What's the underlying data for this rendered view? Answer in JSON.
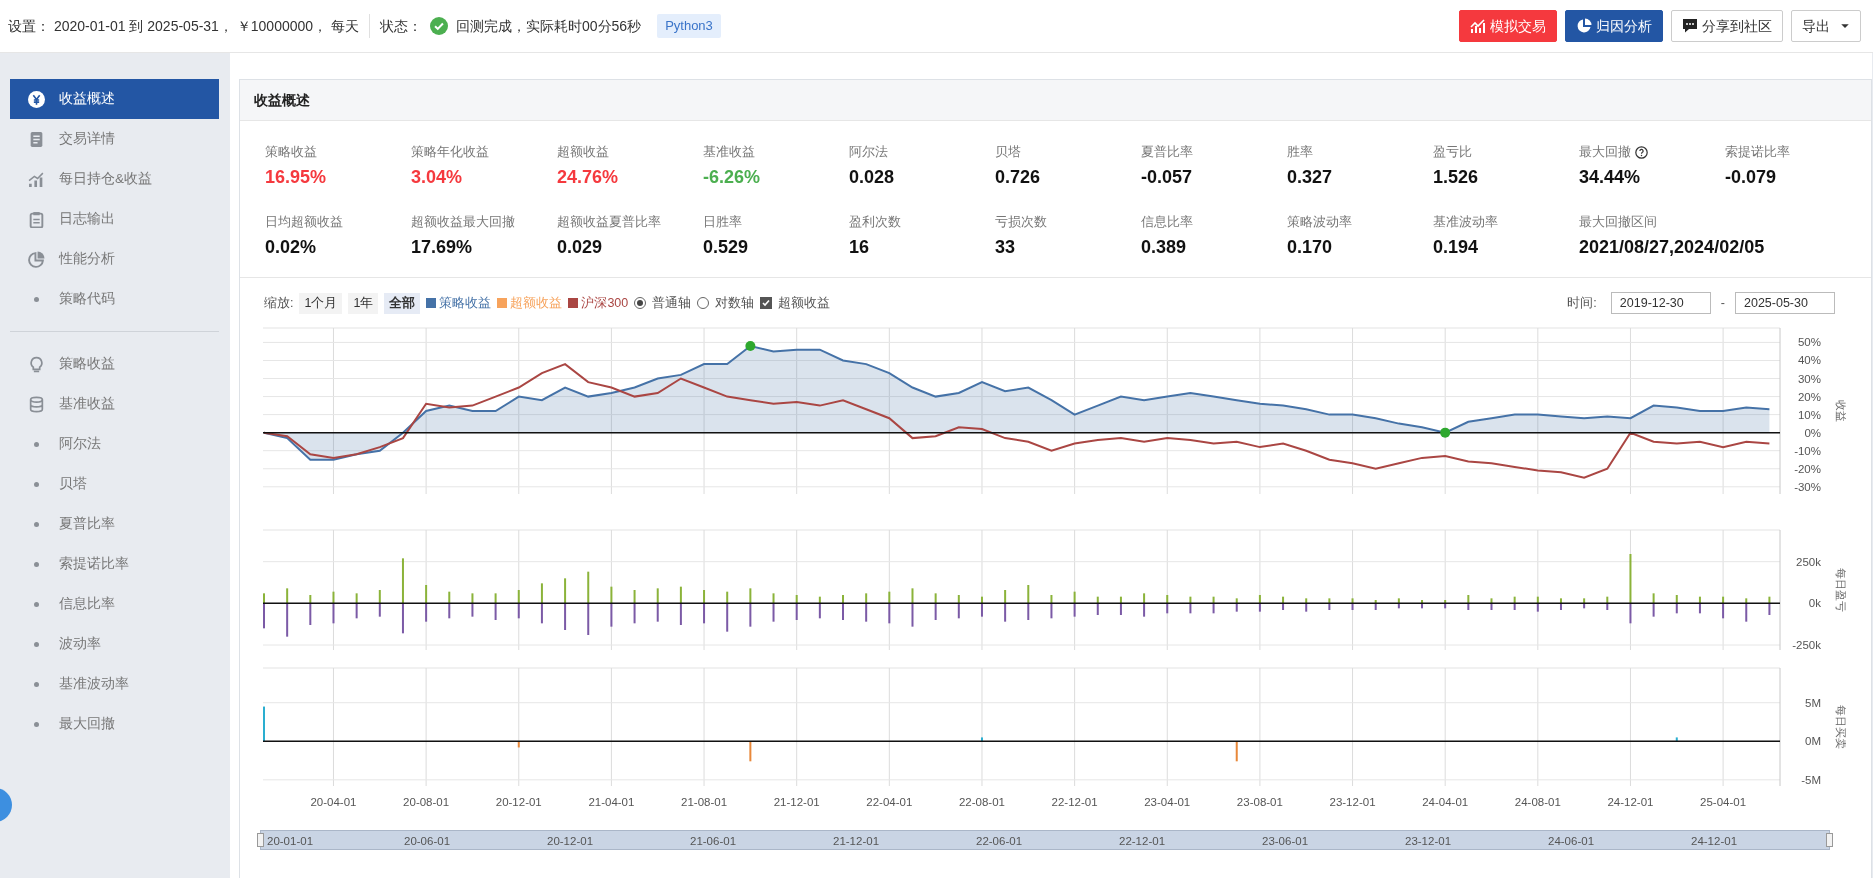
{
  "toolbar": {
    "settings": "设置： 2020-01-01 到 2025-05-31， ￥10000000， 每天",
    "status_label": "状态：",
    "status_done": true,
    "status_text": "回测完成，实际耗时00分56秒",
    "badge": "Python3",
    "buttons": [
      {
        "label": "模拟交易",
        "kind": "simulate"
      },
      {
        "label": "归因分析",
        "kind": "attribution"
      },
      {
        "label": "分享到社区",
        "kind": "share"
      },
      {
        "label": "导出",
        "kind": "dropdown"
      }
    ]
  },
  "sidebar": {
    "groups": [
      [
        {
          "label": "收益概述",
          "kind": "yen",
          "selected": true
        },
        {
          "label": "交易详情",
          "kind": "document",
          "selected": false
        },
        {
          "label": "每日持仓&收益",
          "kind": "bars",
          "selected": false
        },
        {
          "label": "日志输出",
          "kind": "clipboard",
          "selected": false
        },
        {
          "label": "性能分析",
          "kind": "pie",
          "selected": false
        },
        {
          "label": "策略代码",
          "kind": "dot",
          "selected": false
        }
      ],
      [
        {
          "label": "策略收益",
          "kind": "bulb",
          "selected": false
        },
        {
          "label": "基准收益",
          "kind": "database",
          "selected": false
        },
        {
          "label": "阿尔法",
          "kind": "dot",
          "selected": false
        },
        {
          "label": "贝塔",
          "kind": "dot",
          "selected": false
        },
        {
          "label": "夏普比率",
          "kind": "dot",
          "selected": false
        },
        {
          "label": "索提诺比率",
          "kind": "dot",
          "selected": false
        },
        {
          "label": "信息比率",
          "kind": "dot",
          "selected": false
        },
        {
          "label": "波动率",
          "kind": "dot",
          "selected": false
        },
        {
          "label": "基准波动率",
          "kind": "dot",
          "selected": false
        },
        {
          "label": "最大回撤",
          "kind": "dot",
          "selected": false
        }
      ]
    ]
  },
  "panel": {
    "title": "收益概述",
    "metrics": [
      {
        "label": "策略收益",
        "value": "16.95%",
        "color": "#f5393e"
      },
      {
        "label": "策略年化收益",
        "value": "3.04%",
        "color": "#f5393e"
      },
      {
        "label": "超额收益",
        "value": "24.76%",
        "color": "#f5393e"
      },
      {
        "label": "基准收益",
        "value": "-6.26%",
        "color": "#4caf50"
      },
      {
        "label": "阿尔法",
        "value": "0.028"
      },
      {
        "label": "贝塔",
        "value": "0.726"
      },
      {
        "label": "夏普比率",
        "value": "-0.057"
      },
      {
        "label": "胜率",
        "value": "0.327"
      },
      {
        "label": "盈亏比",
        "value": "1.526"
      },
      {
        "label": "最大回撤",
        "value": "34.44%",
        "help": true
      },
      {
        "label": "索提诺比率",
        "value": "-0.079"
      },
      {
        "label": "日均超额收益",
        "value": "0.02%"
      },
      {
        "label": "超额收益最大回撤",
        "value": "17.69%"
      },
      {
        "label": "超额收益夏普比率",
        "value": "0.029"
      },
      {
        "label": "日胜率",
        "value": "0.529"
      },
      {
        "label": "盈利次数",
        "value": "16"
      },
      {
        "label": "亏损次数",
        "value": "33"
      },
      {
        "label": "信息比率",
        "value": "0.389"
      },
      {
        "label": "策略波动率",
        "value": "0.170"
      },
      {
        "label": "基准波动率",
        "value": "0.194"
      },
      {
        "label": "最大回撤区间",
        "value": "2021/08/27,2024/02/05"
      }
    ],
    "chart_controls": {
      "zoom_label": "缩放:",
      "zoom_options": [
        {
          "label": "1个月",
          "selected": false
        },
        {
          "label": "1年",
          "selected": false
        },
        {
          "label": "全部",
          "selected": true
        }
      ],
      "legend": [
        {
          "label": "策略收益",
          "color": "#4572a7"
        },
        {
          "label": "超额收益",
          "color": "#f7a35c"
        },
        {
          "label": "沪深300",
          "color": "#aa4643"
        }
      ],
      "axis_modes": [
        {
          "label": "普通轴",
          "selected": true
        },
        {
          "label": "对数轴",
          "selected": false
        }
      ],
      "excess_toggle": {
        "label": "超额收益",
        "checked": true
      },
      "time_label": "时间:",
      "start": "2019-12-30",
      "separator": "-",
      "end": "2025-05-30"
    },
    "charts": [
      {
        "chart_data": {
          "type": "line",
          "grid": true,
          "ylabel": "收益",
          "ylim": [
            -34,
            58
          ],
          "yticks": [
            {
              "value": -30,
              "label": "-30%"
            },
            {
              "value": -20,
              "label": "-20%"
            },
            {
              "value": -10,
              "label": "-10%"
            },
            {
              "value": 0,
              "label": "0%"
            },
            {
              "value": 10,
              "label": "10%"
            },
            {
              "value": 20,
              "label": "20%"
            },
            {
              "value": 30,
              "label": "30%"
            },
            {
              "value": 40,
              "label": "40%"
            },
            {
              "value": 50,
              "label": "50%"
            }
          ],
          "series": [
            {
              "type": "area",
              "color": "#4572a7",
              "values": [
                0,
                -3,
                -15,
                -15,
                -12,
                -10,
                0,
                12,
                15,
                12,
                12,
                20,
                18,
                25,
                20,
                22,
                25,
                30,
                32,
                38,
                38,
                48,
                45,
                46,
                46,
                40,
                38,
                33,
                25,
                20,
                22,
                28,
                23,
                25,
                18,
                10,
                15,
                20,
                18,
                20,
                22,
                20,
                18,
                16,
                15,
                13,
                10,
                10,
                8,
                5,
                3,
                0,
                6,
                8,
                10,
                10,
                9,
                8,
                9,
                8,
                15,
                14,
                12,
                12,
                14,
                13
              ]
            },
            {
              "type": "line",
              "color": "#aa4643",
              "values": [
                0,
                -2,
                -12,
                -14,
                -12,
                -8,
                -3,
                16,
                14,
                15,
                20,
                25,
                33,
                38,
                28,
                25,
                20,
                22,
                30,
                25,
                20,
                18,
                16,
                17,
                15,
                18,
                13,
                8,
                -3,
                -2,
                3,
                2,
                -3,
                -5,
                -10,
                -6,
                -4,
                -3,
                -5,
                -3,
                -4,
                -6,
                -5,
                -8,
                -6,
                -10,
                -15,
                -17,
                -20,
                -17,
                -14,
                -13,
                -16,
                -17,
                -19,
                -21,
                -22,
                -25,
                -20,
                0,
                -5,
                -6,
                -5,
                -8,
                -5,
                -6
              ]
            }
          ]
        }
      },
      {
        "chart_data": {
          "type": "bar",
          "grid": true,
          "ylabel": "每日盈亏",
          "ylim": [
            -280,
            440
          ],
          "yticks": [
            {
              "value": -250,
              "label": "-250k"
            },
            {
              "value": 0,
              "label": "0k"
            },
            {
              "value": 250,
              "label": "250k"
            }
          ],
          "series": [
            {
              "color": "#8bb33a",
              "values": [
                60,
                90,
                50,
                70,
                60,
                80,
                270,
                110,
                70,
                60,
                60,
                80,
                120,
                150,
                190,
                100,
                80,
                90,
                100,
                80,
                70,
                90,
                60,
                50,
                40,
                50,
                60,
                70,
                90,
                60,
                50,
                40,
                80,
                110,
                50,
                70,
                40,
                40,
                60,
                50,
                40,
                40,
                30,
                50,
                40,
                30,
                30,
                30,
                20,
                30,
                20,
                20,
                50,
                30,
                40,
                40,
                30,
                30,
                40,
                296,
                60,
                50,
                40,
                40,
                30,
                40
              ]
            },
            {
              "color": "#7b5aa6",
              "values": [
                -150,
                -200,
                -130,
                -120,
                -90,
                -80,
                -180,
                -110,
                -90,
                -80,
                -100,
                -90,
                -120,
                -160,
                -190,
                -140,
                -120,
                -110,
                -130,
                -120,
                -170,
                -140,
                -110,
                -100,
                -90,
                -100,
                -110,
                -120,
                -140,
                -100,
                -90,
                -80,
                -110,
                -100,
                -90,
                -80,
                -70,
                -70,
                -80,
                -60,
                -60,
                -60,
                -50,
                -50,
                -40,
                -50,
                -40,
                -40,
                -40,
                -30,
                -30,
                -30,
                -40,
                -40,
                -40,
                -50,
                -40,
                -30,
                -40,
                -120,
                -80,
                -60,
                -60,
                -90,
                -110,
                -70
              ]
            }
          ]
        }
      },
      {
        "chart_data": {
          "type": "bar",
          "grid": true,
          "ylabel": "每日买卖",
          "ylim": [
            -5.8,
            9.5
          ],
          "categories": [
            null,
            null,
            null,
            "20-04-01",
            null,
            null,
            null,
            "20-08-01",
            null,
            null,
            null,
            "20-12-01",
            null,
            null,
            null,
            "21-04-01",
            null,
            null,
            null,
            "21-08-01",
            null,
            null,
            null,
            "21-12-01",
            null,
            null,
            null,
            "22-04-01",
            null,
            null,
            null,
            "22-08-01",
            null,
            null,
            null,
            "22-12-01",
            null,
            null,
            null,
            "23-04-01",
            null,
            null,
            null,
            "23-08-01",
            null,
            null,
            null,
            "23-12-01",
            null,
            null,
            null,
            "24-04-01",
            null,
            null,
            null,
            "24-08-01",
            null,
            null,
            null,
            "24-12-01",
            null,
            null,
            null,
            "25-04-01",
            null,
            null
          ],
          "yticks": [
            {
              "value": -5,
              "label": "-5M"
            },
            {
              "value": 0,
              "label": "0M"
            },
            {
              "value": 5,
              "label": "5M"
            }
          ],
          "series": [
            {
              "color": "#2aaed0",
              "values": [
                4.5,
                null,
                null,
                null,
                null,
                null,
                null,
                null,
                null,
                null,
                null,
                null,
                null,
                null,
                null,
                null,
                null,
                null,
                null,
                null,
                null,
                null,
                null,
                null,
                null,
                null,
                null,
                null,
                null,
                null,
                null,
                0.5,
                null,
                null,
                null,
                null,
                null,
                null,
                null,
                null,
                null,
                null,
                null,
                null,
                null,
                null,
                null,
                null,
                null,
                null,
                null,
                null,
                null,
                null,
                null,
                null,
                null,
                null,
                null,
                null,
                null,
                0.5,
                null,
                null,
                null,
                null
              ]
            },
            {
              "color": "#e8883a",
              "values": [
                null,
                null,
                null,
                null,
                null,
                null,
                null,
                null,
                null,
                null,
                null,
                -0.8,
                null,
                null,
                null,
                null,
                null,
                null,
                null,
                null,
                null,
                -2.6,
                null,
                null,
                null,
                null,
                null,
                null,
                null,
                null,
                null,
                null,
                null,
                null,
                null,
                null,
                null,
                null,
                null,
                null,
                null,
                null,
                -2.6,
                null,
                null,
                null,
                null,
                null,
                null,
                null,
                null,
                null,
                null,
                null,
                null,
                null,
                null,
                null,
                null,
                null,
                null,
                null,
                null,
                null,
                null,
                null
              ]
            }
          ]
        }
      }
    ],
    "navigator": {
      "labels": [
        "20-01-01",
        "20-06-01",
        "20-12-01",
        "21-06-01",
        "21-12-01",
        "22-06-01",
        "22-12-01",
        "23-06-01",
        "23-12-01",
        "24-06-01",
        "24-12-01"
      ]
    }
  }
}
